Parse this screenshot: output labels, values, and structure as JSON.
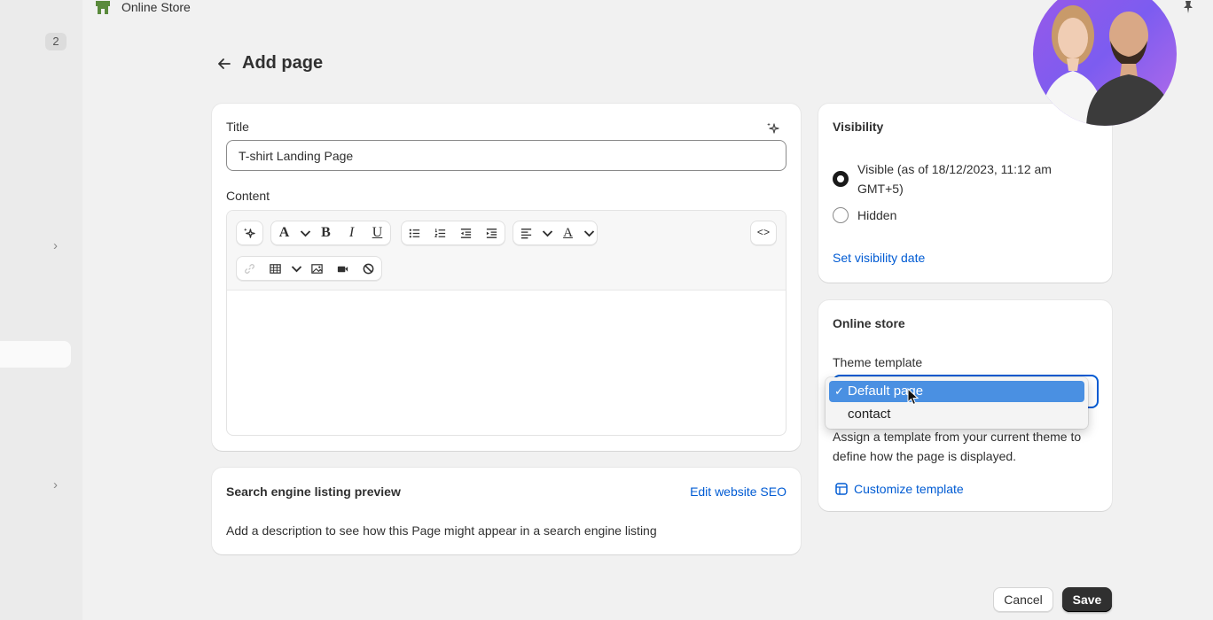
{
  "topbar": {
    "store_name": "Online Store"
  },
  "sidebar": {
    "badge": "2"
  },
  "page": {
    "title": "Add page"
  },
  "main": {
    "title_label": "Title",
    "title_value": "T-shirt Landing Page",
    "content_label": "Content",
    "toolbar": {
      "font_letter": "A",
      "bold": "B",
      "italic": "I",
      "underline": "U",
      "color_letter": "A",
      "code": "<>"
    }
  },
  "seo": {
    "title": "Search engine listing preview",
    "edit_link": "Edit website SEO",
    "description": "Add a description to see how this Page might appear in a search engine listing"
  },
  "visibility": {
    "title": "Visibility",
    "visible_label_line1": "Visible (as of 18/12/2023, 11:12 am",
    "visible_label_line2": "GMT+5)",
    "hidden_label": "Hidden",
    "set_date_link": "Set visibility date"
  },
  "online_store": {
    "title": "Online store",
    "template_label": "Theme template",
    "options": [
      "Default page",
      "contact"
    ],
    "selected_index": 0,
    "help_text": "Assign a template from your current theme to define how the page is displayed.",
    "customize_link": "Customize template"
  },
  "footer": {
    "cancel": "Cancel",
    "save": "Save"
  },
  "colors": {
    "link": "#005bd3",
    "primary_button": "#303030",
    "selected_option": "#4a90e2"
  }
}
